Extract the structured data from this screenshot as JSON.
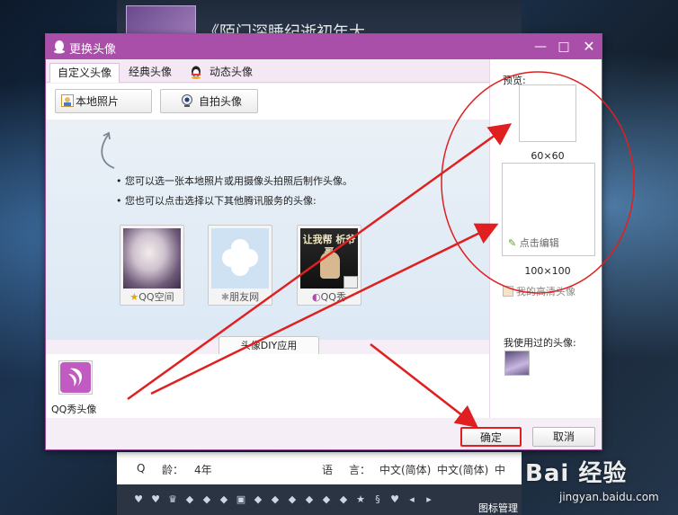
{
  "dialog": {
    "title": "更换头像",
    "tabs": [
      {
        "label": "自定义头像",
        "active": true
      },
      {
        "label": "经典头像",
        "active": false
      },
      {
        "label": "动态头像",
        "active": false
      }
    ],
    "toolbar": {
      "local_photo_label": "本地照片",
      "selfie_label": "自拍头像"
    },
    "hints": [
      "• 您可以选一张本地照片或用摄像头拍照后制作头像。",
      "• 您也可以点击选择以下其他腾讯服务的头像:"
    ],
    "services": [
      {
        "caption": "QQ空间"
      },
      {
        "caption": "朋友网"
      },
      {
        "caption": "QQ秀",
        "image_text": "让我帮 析爷哥"
      }
    ],
    "diy_label": "头像DIY应用",
    "qqshow_label": "QQ秀头像",
    "preview": {
      "label": "预览:",
      "small_size": "60×60",
      "large_size": "100×100",
      "edit_label": "点击编辑",
      "hd_link": "我的高清头像",
      "used_label": "我使用过的头像:"
    },
    "buttons": {
      "ok": "确定",
      "cancel": "取消"
    }
  },
  "background": {
    "top_title_fragment": "《陌门深睡纪逝初年大",
    "info": {
      "q_label": "Q",
      "age_label": "龄：",
      "age_value": "4年",
      "lang_label": "语",
      "lang_label2": "言：",
      "lang_value1": "中文(简体)",
      "lang_value2": "中文(简体)",
      "lang_value3": "中"
    },
    "icon_manage_label": "图标管理"
  },
  "watermark": {
    "main": "Bai 经验",
    "sub": "jingyan.baidu.com"
  },
  "colors": {
    "title_bar": "#a94ea9",
    "annotation_red": "#e02020"
  }
}
